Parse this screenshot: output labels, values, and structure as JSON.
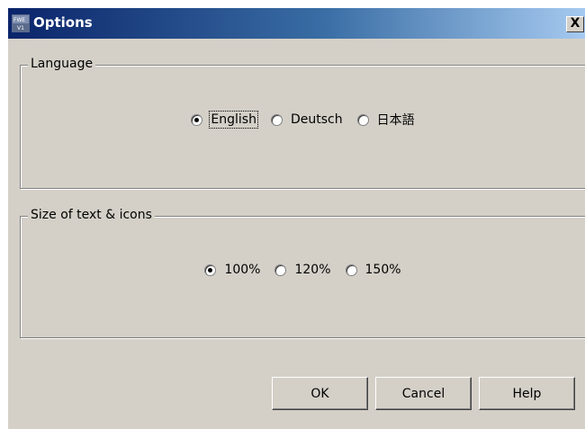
{
  "window": {
    "title": "Options",
    "app_icon": "fwe-app-icon",
    "close_label": "X"
  },
  "language_group": {
    "label": "Language",
    "options": [
      {
        "label": "English",
        "checked": true
      },
      {
        "label": "Deutsch",
        "checked": false
      },
      {
        "label": "日本語",
        "checked": false
      }
    ]
  },
  "size_group": {
    "label": "Size of text & icons",
    "options": [
      {
        "label": "100%",
        "checked": true
      },
      {
        "label": "120%",
        "checked": false
      },
      {
        "label": "150%",
        "checked": false
      }
    ]
  },
  "buttons": {
    "ok": "OK",
    "cancel": "Cancel",
    "help": "Help"
  },
  "colors": {
    "face": "#d4d0c8",
    "titlebar_start": "#0a246a",
    "titlebar_end": "#a6caf0"
  }
}
